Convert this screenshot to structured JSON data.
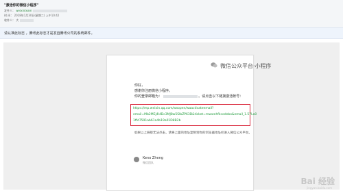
{
  "header": {
    "subject": "\"激活你的微信小程序\"",
    "from_label": "发件人：",
    "from_name": "weixinteam",
    "time_label": "时 间：",
    "time_value": "2018年1月30日(星期二) 上午10:42",
    "to_label": "收件人：",
    "to_value": "大"
  },
  "notice": {
    "text": "请认准此标志 ，腾讯此标志才是发自腾讯公司的系统邮件。"
  },
  "email": {
    "brand": "微信公众平台·小程序",
    "greeting": "你好，",
    "line2": "感谢你注册微信小程序。",
    "line3_prefix": "你的登录邮箱为：",
    "line3_suffix": "。请点击以下链接激活帐号：",
    "link_lines": [
      "https://mp.weixin.qq.com/wxopen/waactivateemail?",
      "email=Mb2MEj4I4Dc3MJ8w5SlbZP63D&ticket=mwwehfkcodebo&email_1.57La0",
      "1ffd7591ab61a4b19a01D8B2b"
    ],
    "after_link": "如果以上链接无法点击，请将上面的地址复制到你的浏览器地址栏进入微信公众平台。",
    "signature_name": "Keno Zheng",
    "signature_role": "微信团队"
  },
  "watermark": {
    "text": "Bai 经验",
    "sub": "jingyan.baidu.com"
  },
  "colors": {
    "link": "#1e9a3a",
    "highlight_box": "#d9263a",
    "notice_bg": "#eef4fc"
  },
  "icons": [
    "wechat-logo-icon",
    "avatar"
  ]
}
